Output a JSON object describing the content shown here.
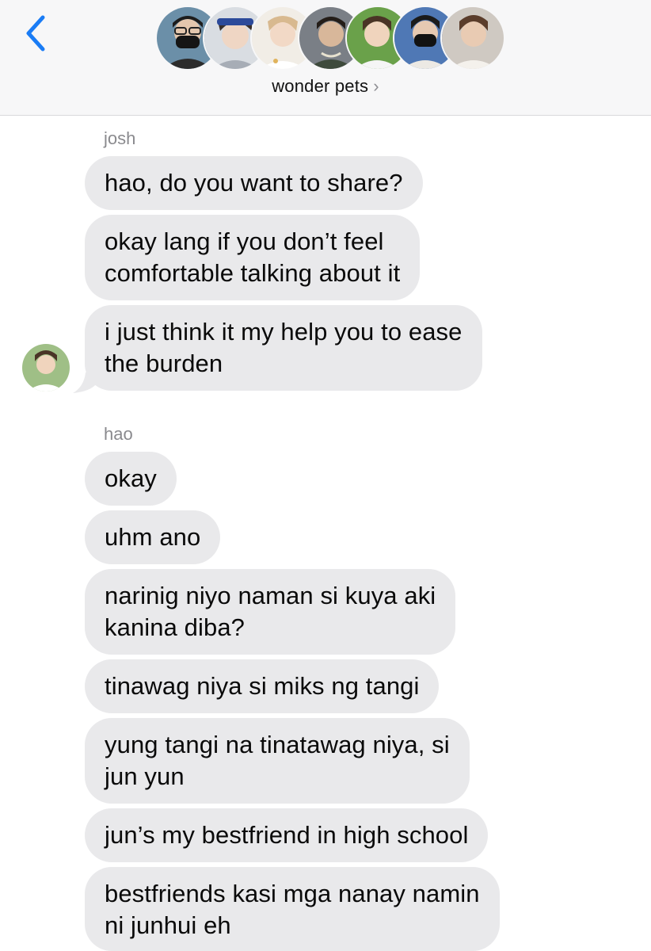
{
  "header": {
    "back_icon": "chevron-left-icon",
    "group_name": "wonder pets",
    "chevron": "›",
    "accent": "#1a7cf5"
  },
  "messages": {
    "josh_label": "josh",
    "josh": [
      "hao, do you want to share?",
      "okay lang if you don’t feel\ncomfortable talking about it",
      "i just think it my help you to ease\nthe burden"
    ],
    "hao_label": "hao",
    "hao": [
      "okay",
      "uhm ano",
      "narinig niyo naman si kuya aki\nkanina diba?",
      "tinawag niya si miks ng tangi",
      "yung tangi na tinatawag niya, si\njun yun",
      "jun’s my bestfriend in high school",
      "bestfriends kasi mga nanay namin\nni junhui eh"
    ]
  },
  "colors": {
    "bubble_bg": "#e9e9eb",
    "header_bg": "#f7f7f8",
    "sender_label": "#8a8a8e"
  }
}
